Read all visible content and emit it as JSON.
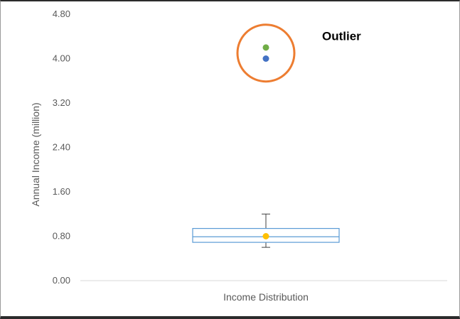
{
  "chart_data": {
    "type": "box",
    "ylabel": "Annual Income (million)",
    "ylim": [
      0,
      4.8
    ],
    "y_ticks": [
      "0.00",
      "0.80",
      "1.60",
      "2.40",
      "3.20",
      "4.00",
      "4.80"
    ],
    "y_tick_values": [
      0,
      0.8,
      1.6,
      2.4,
      3.2,
      4.0,
      4.8
    ],
    "categories": [
      "Income Distribution"
    ],
    "grid": false,
    "box": {
      "min": 0.6,
      "q1": 0.69,
      "median": 0.79,
      "q3": 0.94,
      "max": 1.2,
      "mean": 0.8
    },
    "outliers": [
      {
        "y": 4.2,
        "color": "#70ad47"
      },
      {
        "y": 4.0,
        "color": "#4472c4"
      }
    ],
    "annotation": {
      "text": "Outlier",
      "highlight_color": "#ed7d31"
    },
    "colors": {
      "box": "#5b9bd5",
      "whisker": "#404040",
      "mean_marker": "#ffc000",
      "axis_text": "#595959",
      "baseline": "#d9d9d9"
    }
  }
}
